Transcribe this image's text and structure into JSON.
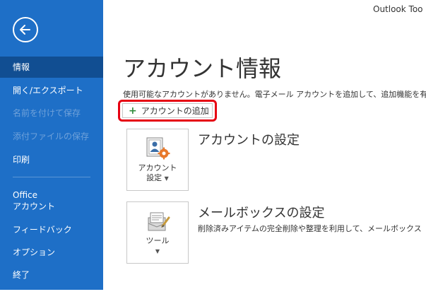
{
  "app": {
    "title": "Outlook Too"
  },
  "sidebar": {
    "items": [
      {
        "label": "情報",
        "state": "active"
      },
      {
        "label": "開く/エクスポート",
        "state": "normal"
      },
      {
        "label": "名前を付けて保存",
        "state": "disabled"
      },
      {
        "label": "添付ファイルの保存",
        "state": "disabled"
      },
      {
        "label": "印刷",
        "state": "normal"
      },
      {
        "label": "Office",
        "label2": "アカウント",
        "state": "normal"
      },
      {
        "label": "フィードバック",
        "state": "normal"
      },
      {
        "label": "オプション",
        "state": "normal"
      },
      {
        "label": "終了",
        "state": "normal"
      }
    ]
  },
  "main": {
    "title": "アカウント情報",
    "info_text": "使用可能なアカウントがありません。電子メール アカウントを追加して、追加機能を有",
    "add_account_label": "アカウントの追加",
    "account_settings": {
      "tile_line1": "アカウント",
      "tile_line2": "設定",
      "heading": "アカウントの設定"
    },
    "mailbox_settings": {
      "tile_label": "ツール",
      "heading": "メールボックスの設定",
      "description": "削除済みアイテムの完全削除や整理を利用して、メールボックス"
    }
  },
  "colors": {
    "sidebar": "#1e6fc7",
    "sidebar_active": "#114e92",
    "highlight": "#e60012",
    "plus": "#2e8b3a"
  }
}
